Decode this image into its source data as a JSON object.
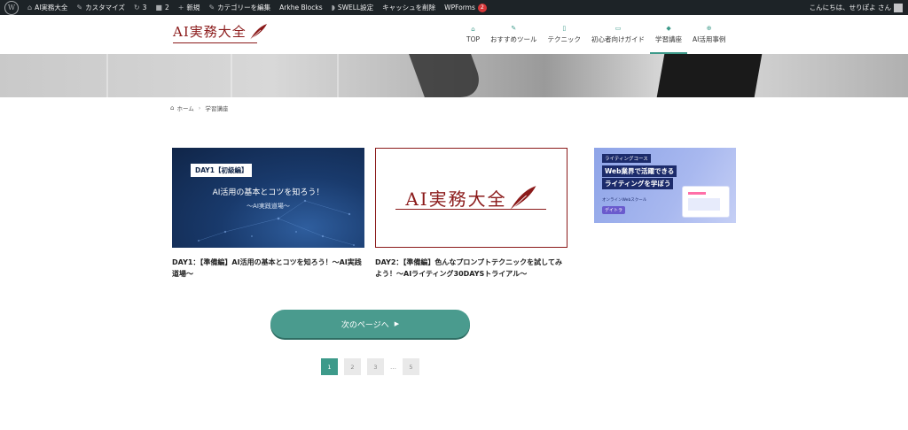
{
  "adminbar": {
    "site_name": "AI実務大全",
    "customize": "カスタマイズ",
    "updates_count": "3",
    "comments_count": "2",
    "new_label": "新規",
    "edit_category": "カテゴリーを編集",
    "arkhe": "Arkhe Blocks",
    "swell": "SWELL設定",
    "cache": "キャッシュを削除",
    "wpforms": "WPForms",
    "wpforms_badge": "2",
    "greeting": "こんにちは、せりぽよ さん"
  },
  "header": {
    "logo_text": "AI実務大全",
    "nav": [
      {
        "label": "TOP",
        "icon": "home-icon"
      },
      {
        "label": "おすすめツール",
        "icon": "tool-icon"
      },
      {
        "label": "テクニック",
        "icon": "book-icon"
      },
      {
        "label": "初心者向けガイド",
        "icon": "guide-icon"
      },
      {
        "label": "学習講座",
        "icon": "graduation-icon"
      },
      {
        "label": "AI活用事例",
        "icon": "search-icon"
      }
    ],
    "active_nav": "学習講座"
  },
  "breadcrumb": {
    "home": "ホーム",
    "current": "学習講座"
  },
  "cards": [
    {
      "thumb_tag": "DAY1【初級編】",
      "thumb_title": "AI活用の基本とコツを知ろう！",
      "thumb_sub": "〜AI実践道場〜",
      "title": "DAY1：【準備編】AI活用の基本とコツを知ろう！〜AI実践道場〜"
    },
    {
      "thumb_logo": "AI実務大全",
      "title": "DAY2：【準備編】色んなプロンプトテクニックを試してみよう！〜AIライティング30DAYSトライアル〜"
    }
  ],
  "banner": {
    "tag": "ライティングコース",
    "line1": "Web業界で活躍できる",
    "line2": "ライティングを学ぼう",
    "small": "オンラインWebスクール",
    "brand": "デイトラ"
  },
  "next_button": "次のページへ",
  "pagination": {
    "pages": [
      "1",
      "2",
      "3"
    ],
    "current": "1",
    "dots": "…",
    "last": "5"
  },
  "colors": {
    "accent": "#3d9a8a",
    "brand": "#8b1a1a",
    "adminbar": "#1d2327"
  }
}
